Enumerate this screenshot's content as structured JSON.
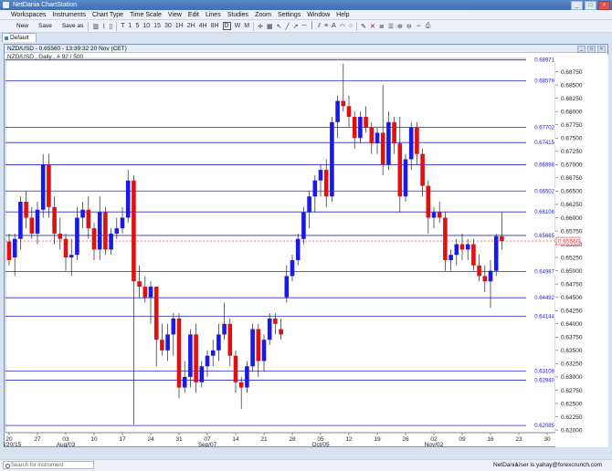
{
  "window": {
    "title": "NetDania ChartStation",
    "buttons": [
      "_",
      "□",
      "×"
    ]
  },
  "menu": [
    "Workspaces",
    "Instruments",
    "Chart Type",
    "Time Scale",
    "View",
    "Edit",
    "Lines",
    "Studies",
    "Zoom",
    "Settings",
    "Window",
    "Help"
  ],
  "toolbar": {
    "buttons": [
      "New",
      "Save",
      "Save as"
    ],
    "icons": [
      "bar-chart-icon",
      "line-chart-icon",
      "candle-icon"
    ],
    "timescales": [
      "T",
      "1",
      "5",
      "10",
      "15",
      "30",
      "1H",
      "2H",
      "4H",
      "8H",
      "D",
      "W",
      "M"
    ],
    "selected_timescale": "D"
  },
  "tab": {
    "label": "Default"
  },
  "chart": {
    "title": "NZD/USD - 0.65560 - 13:39:32  20 Nov (CET)",
    "info": "NZD/USD , Daily , # 92 / 500",
    "accent": "#1a1ae6",
    "up_color": "#1a1ae6",
    "down_color": "#dd1111",
    "current_price_label": "0.65560"
  },
  "chart_data": {
    "type": "candlestick",
    "y_ticks": [
      "0.68750",
      "0.68500",
      "0.68250",
      "0.68000",
      "0.67750",
      "0.67500",
      "0.67250",
      "0.67000",
      "0.66750",
      "0.66500",
      "0.66250",
      "0.66000",
      "0.65750",
      "0.65500",
      "0.65250",
      "0.65000",
      "0.64750",
      "0.64500",
      "0.64250",
      "0.64000",
      "0.63750",
      "0.63500",
      "0.63250",
      "0.63000",
      "0.62750",
      "0.62500",
      "0.62250",
      "0.62000"
    ],
    "ylim": [
      0.6195,
      0.69
    ],
    "horizontal_lines": [
      0.68971,
      0.68579,
      0.67702,
      0.67415,
      0.66998,
      0.66502,
      0.66108,
      0.65665,
      0.64987,
      0.64492,
      0.64144,
      0.63108,
      0.6294,
      0.62085
    ],
    "horizontal_line_labels": [
      "0.68971",
      "0.68579",
      "0.67702",
      "0.67415",
      "0.66998",
      "0.66502",
      "0.66108",
      "0.65665",
      "0.64987",
      "0.64492",
      "0.64144",
      "0.63108",
      "0.62940",
      "0.62085"
    ],
    "current_price": 0.6556,
    "x_tick_labels": [
      "20",
      "27",
      "03",
      "10",
      "17",
      "24",
      "31",
      "07",
      "14",
      "21",
      "28",
      "05",
      "12",
      "19",
      "26",
      "02",
      "09",
      "16",
      "23",
      "30"
    ],
    "x_period_labels": [
      "Jul/20/15",
      "Aug/03",
      "Sep/07",
      "Oct/05",
      "Nov/02"
    ],
    "period_label_ticks": [
      0,
      2,
      7,
      11,
      15
    ],
    "candles": [
      [
        0.6555,
        0.657,
        0.651,
        0.652
      ],
      [
        0.6525,
        0.657,
        0.649,
        0.656
      ],
      [
        0.656,
        0.664,
        0.654,
        0.663
      ],
      [
        0.663,
        0.665,
        0.658,
        0.66
      ],
      [
        0.66,
        0.662,
        0.656,
        0.657
      ],
      [
        0.657,
        0.663,
        0.655,
        0.6615
      ],
      [
        0.6615,
        0.672,
        0.66,
        0.67
      ],
      [
        0.67,
        0.672,
        0.66,
        0.662
      ],
      [
        0.662,
        0.664,
        0.655,
        0.657
      ],
      [
        0.657,
        0.66,
        0.654,
        0.656
      ],
      [
        0.656,
        0.657,
        0.65,
        0.6525
      ],
      [
        0.6525,
        0.656,
        0.649,
        0.653
      ],
      [
        0.653,
        0.662,
        0.652,
        0.66
      ],
      [
        0.66,
        0.663,
        0.658,
        0.6615
      ],
      [
        0.6615,
        0.664,
        0.656,
        0.658
      ],
      [
        0.658,
        0.659,
        0.652,
        0.654
      ],
      [
        0.654,
        0.664,
        0.652,
        0.661
      ],
      [
        0.661,
        0.662,
        0.653,
        0.654
      ],
      [
        0.654,
        0.658,
        0.653,
        0.657
      ],
      [
        0.657,
        0.66,
        0.656,
        0.658
      ],
      [
        0.658,
        0.662,
        0.657,
        0.66
      ],
      [
        0.66,
        0.669,
        0.659,
        0.667
      ],
      [
        0.667,
        0.668,
        0.621,
        0.648
      ],
      [
        0.648,
        0.651,
        0.645,
        0.647
      ],
      [
        0.647,
        0.649,
        0.644,
        0.645
      ],
      [
        0.645,
        0.648,
        0.64,
        0.647
      ],
      [
        0.647,
        0.647,
        0.632,
        0.637
      ],
      [
        0.637,
        0.64,
        0.634,
        0.635
      ],
      [
        0.635,
        0.64,
        0.633,
        0.638
      ],
      [
        0.638,
        0.642,
        0.634,
        0.641
      ],
      [
        0.641,
        0.642,
        0.626,
        0.628
      ],
      [
        0.628,
        0.633,
        0.627,
        0.63
      ],
      [
        0.63,
        0.639,
        0.628,
        0.638
      ],
      [
        0.638,
        0.64,
        0.627,
        0.629
      ],
      [
        0.629,
        0.633,
        0.628,
        0.632
      ],
      [
        0.632,
        0.635,
        0.63,
        0.634
      ],
      [
        0.634,
        0.637,
        0.632,
        0.635
      ],
      [
        0.635,
        0.64,
        0.633,
        0.638
      ],
      [
        0.638,
        0.644,
        0.637,
        0.64
      ],
      [
        0.64,
        0.641,
        0.632,
        0.634
      ],
      [
        0.634,
        0.635,
        0.627,
        0.629
      ],
      [
        0.629,
        0.63,
        0.624,
        0.628
      ],
      [
        0.628,
        0.633,
        0.627,
        0.632
      ],
      [
        0.632,
        0.64,
        0.631,
        0.639
      ],
      [
        0.639,
        0.64,
        0.63,
        0.633
      ],
      [
        0.633,
        0.638,
        0.631,
        0.637
      ],
      [
        0.637,
        0.642,
        0.636,
        0.641
      ],
      [
        0.641,
        0.642,
        0.638,
        0.64
      ],
      [
        0.639,
        0.641,
        0.637,
        0.638
      ],
      [
        0.645,
        0.651,
        0.644,
        0.649
      ],
      [
        0.649,
        0.653,
        0.648,
        0.652
      ],
      [
        0.652,
        0.657,
        0.651,
        0.656
      ],
      [
        0.656,
        0.662,
        0.655,
        0.661
      ],
      [
        0.661,
        0.665,
        0.658,
        0.664
      ],
      [
        0.664,
        0.668,
        0.661,
        0.667
      ],
      [
        0.667,
        0.67,
        0.664,
        0.669
      ],
      [
        0.669,
        0.671,
        0.662,
        0.664
      ],
      [
        0.664,
        0.679,
        0.663,
        0.678
      ],
      [
        0.678,
        0.683,
        0.675,
        0.682
      ],
      [
        0.682,
        0.689,
        0.68,
        0.681
      ],
      [
        0.681,
        0.683,
        0.677,
        0.679
      ],
      [
        0.679,
        0.68,
        0.673,
        0.675
      ],
      [
        0.675,
        0.68,
        0.674,
        0.679
      ],
      [
        0.679,
        0.681,
        0.676,
        0.677
      ],
      [
        0.677,
        0.678,
        0.672,
        0.674
      ],
      [
        0.674,
        0.677,
        0.672,
        0.676
      ],
      [
        0.676,
        0.685,
        0.668,
        0.67
      ],
      [
        0.67,
        0.68,
        0.669,
        0.678
      ],
      [
        0.678,
        0.679,
        0.672,
        0.674
      ],
      [
        0.674,
        0.679,
        0.661,
        0.664
      ],
      [
        0.664,
        0.672,
        0.663,
        0.671
      ],
      [
        0.671,
        0.678,
        0.669,
        0.677
      ],
      [
        0.677,
        0.678,
        0.67,
        0.672
      ],
      [
        0.672,
        0.673,
        0.664,
        0.666
      ],
      [
        0.666,
        0.667,
        0.657,
        0.66
      ],
      [
        0.66,
        0.662,
        0.658,
        0.661
      ],
      [
        0.661,
        0.663,
        0.659,
        0.66
      ],
      [
        0.66,
        0.661,
        0.65,
        0.652
      ],
      [
        0.652,
        0.654,
        0.65,
        0.653
      ],
      [
        0.653,
        0.656,
        0.651,
        0.655
      ],
      [
        0.655,
        0.657,
        0.652,
        0.654
      ],
      [
        0.654,
        0.656,
        0.652,
        0.655
      ],
      [
        0.655,
        0.656,
        0.65,
        0.651
      ],
      [
        0.651,
        0.653,
        0.648,
        0.649
      ],
      [
        0.649,
        0.651,
        0.646,
        0.648
      ],
      [
        0.648,
        0.652,
        0.643,
        0.65
      ],
      [
        0.65,
        0.657,
        0.649,
        0.6565
      ],
      [
        0.6565,
        0.661,
        0.654,
        0.6556
      ]
    ]
  },
  "status": {
    "search_placeholder": "Search for instrument",
    "brand": "NetDania",
    "user": "User is yahay@forexcrunch.com"
  }
}
